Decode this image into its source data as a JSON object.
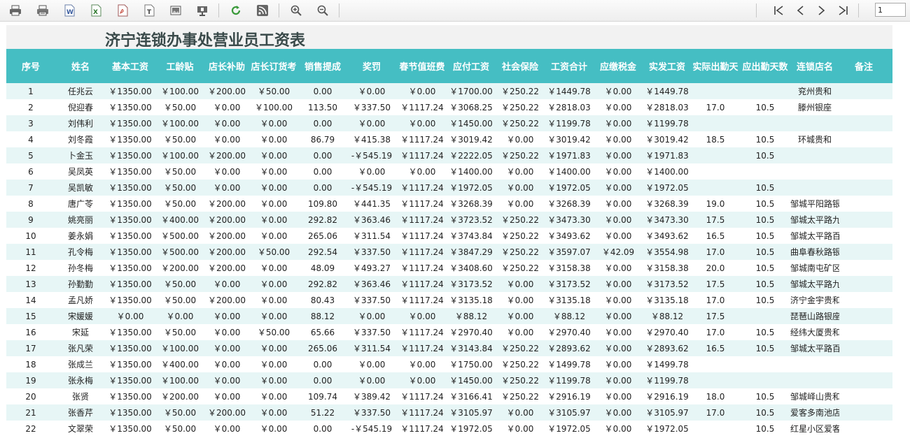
{
  "toolbar": {
    "page_number": "1",
    "icons": [
      "print-icon",
      "print-preview-icon",
      "export-word-icon",
      "export-excel-icon",
      "export-pdf-icon",
      "export-text-icon",
      "export-image-icon",
      "presentation-icon",
      "refresh-icon",
      "rss-icon",
      "zoom-in-icon",
      "zoom-out-icon",
      "first-page-icon",
      "prev-page-icon",
      "next-page-icon",
      "last-page-icon"
    ]
  },
  "colors": {
    "header_bg": "#45bec3",
    "row_alt_bg": "#e7f6f6",
    "title_bg": "#f2f2f2"
  },
  "report": {
    "title": "济宁连锁办事处营业员工资表",
    "columns": [
      "序号",
      "姓名",
      "基本工资",
      "工龄贴",
      "店长补助",
      "店长订货考",
      "销售提成",
      "奖罚",
      "春节值班费",
      "应付工资",
      "社会保险",
      "工资合计",
      "应缴税金",
      "实发工资",
      "实际出勤天",
      "应出勤天数",
      "连锁店名",
      "备注"
    ],
    "rows": [
      [
        "1",
        "任兆云",
        "￥1350.00",
        "￥100.00",
        "￥200.00",
        "￥50.00",
        "0.00",
        "￥0.00",
        "￥0.00",
        "￥1700.00",
        "￥250.22",
        "￥1449.78",
        "￥0.00",
        "￥1449.78",
        "",
        "",
        "兖州贵和",
        ""
      ],
      [
        "2",
        "倪迎春",
        "￥1350.00",
        "￥50.00",
        "￥0.00",
        "￥100.00",
        "113.50",
        "￥337.50",
        "￥1117.24",
        "￥3068.25",
        "￥250.22",
        "￥2818.03",
        "￥0.00",
        "￥2818.03",
        "17.0",
        "10.5",
        "滕州银座",
        ""
      ],
      [
        "3",
        "刘伟利",
        "￥1350.00",
        "￥100.00",
        "￥0.00",
        "￥0.00",
        "0.00",
        "￥0.00",
        "￥0.00",
        "￥1450.00",
        "￥250.22",
        "￥1199.78",
        "￥0.00",
        "￥1199.78",
        "",
        "",
        "",
        ""
      ],
      [
        "4",
        "刘冬霞",
        "￥1350.00",
        "￥50.00",
        "￥0.00",
        "￥0.00",
        "86.79",
        "￥415.38",
        "￥1117.24",
        "￥3019.42",
        "￥0.00",
        "￥3019.42",
        "￥0.00",
        "￥3019.42",
        "18.5",
        "10.5",
        "环城贵和",
        ""
      ],
      [
        "5",
        "卜金玉",
        "￥1350.00",
        "￥100.00",
        "￥200.00",
        "￥0.00",
        "0.00",
        "-￥545.19",
        "￥1117.24",
        "￥2222.05",
        "￥250.22",
        "￥1971.83",
        "￥0.00",
        "￥1971.83",
        "",
        "10.5",
        "",
        ""
      ],
      [
        "6",
        "吴凤英",
        "￥1350.00",
        "￥50.00",
        "￥0.00",
        "￥0.00",
        "0.00",
        "￥0.00",
        "￥0.00",
        "￥1400.00",
        "￥0.00",
        "￥1400.00",
        "￥0.00",
        "￥1400.00",
        "",
        "",
        "",
        ""
      ],
      [
        "7",
        "吴凯敏",
        "￥1350.00",
        "￥50.00",
        "￥0.00",
        "￥0.00",
        "0.00",
        "-￥545.19",
        "￥1117.24",
        "￥1972.05",
        "￥0.00",
        "￥1972.05",
        "￥0.00",
        "￥1972.05",
        "",
        "10.5",
        "",
        ""
      ],
      [
        "8",
        "唐广苓",
        "￥1350.00",
        "￥50.00",
        "￥200.00",
        "￥0.00",
        "109.80",
        "￥441.35",
        "￥1117.24",
        "￥3268.39",
        "￥0.00",
        "￥3268.39",
        "￥0.00",
        "￥3268.39",
        "19.0",
        "10.5",
        "邹城平阳路银",
        ""
      ],
      [
        "9",
        "姚亮丽",
        "￥1350.00",
        "￥400.00",
        "￥200.00",
        "￥0.00",
        "292.82",
        "￥363.46",
        "￥1117.24",
        "￥3723.52",
        "￥250.22",
        "￥3473.30",
        "￥0.00",
        "￥3473.30",
        "17.5",
        "10.5",
        "邹城太平路九",
        ""
      ],
      [
        "10",
        "姜永娟",
        "￥1350.00",
        "￥500.00",
        "￥200.00",
        "￥0.00",
        "265.06",
        "￥311.54",
        "￥1117.24",
        "￥3743.84",
        "￥250.22",
        "￥3493.62",
        "￥0.00",
        "￥3493.62",
        "16.5",
        "10.5",
        "邹城太平路百",
        ""
      ],
      [
        "11",
        "孔令梅",
        "￥1350.00",
        "￥500.00",
        "￥200.00",
        "￥50.00",
        "292.54",
        "￥337.50",
        "￥1117.24",
        "￥3847.29",
        "￥250.22",
        "￥3597.07",
        "￥42.09",
        "￥3554.98",
        "17.0",
        "10.5",
        "曲阜春秋路银",
        ""
      ],
      [
        "12",
        "孙冬梅",
        "￥1350.00",
        "￥200.00",
        "￥200.00",
        "￥0.00",
        "48.09",
        "￥493.27",
        "￥1117.24",
        "￥3408.60",
        "￥250.22",
        "￥3158.38",
        "￥0.00",
        "￥3158.38",
        "20.0",
        "10.5",
        "邹城南屯矿区",
        ""
      ],
      [
        "13",
        "孙勤勤",
        "￥1350.00",
        "￥50.00",
        "￥0.00",
        "￥0.00",
        "292.82",
        "￥363.46",
        "￥1117.24",
        "￥3173.52",
        "￥0.00",
        "￥3173.52",
        "￥0.00",
        "￥3173.52",
        "17.5",
        "10.5",
        "邹城太平路九",
        ""
      ],
      [
        "14",
        "孟凡娇",
        "￥1350.00",
        "￥50.00",
        "￥200.00",
        "￥0.00",
        "80.43",
        "￥337.50",
        "￥1117.24",
        "￥3135.18",
        "￥0.00",
        "￥3135.18",
        "￥0.00",
        "￥3135.18",
        "17.0",
        "10.5",
        "济宁金宇贵和",
        ""
      ],
      [
        "15",
        "宋媛媛",
        "￥0.00",
        "￥0.00",
        "￥0.00",
        "￥0.00",
        "88.12",
        "￥0.00",
        "￥0.00",
        "￥88.12",
        "￥0.00",
        "￥88.12",
        "￥0.00",
        "￥88.12",
        "17.5",
        "",
        "琵琶山路银座",
        ""
      ],
      [
        "16",
        "宋延",
        "￥1350.00",
        "￥50.00",
        "￥0.00",
        "￥50.00",
        "65.66",
        "￥337.50",
        "￥1117.24",
        "￥2970.40",
        "￥0.00",
        "￥2970.40",
        "￥0.00",
        "￥2970.40",
        "17.0",
        "10.5",
        "经纬大厦贵和",
        ""
      ],
      [
        "17",
        "张凡荣",
        "￥1350.00",
        "￥100.00",
        "￥0.00",
        "￥0.00",
        "265.06",
        "￥311.54",
        "￥1117.24",
        "￥3143.84",
        "￥250.22",
        "￥2893.62",
        "￥0.00",
        "￥2893.62",
        "16.5",
        "10.5",
        "邹城太平路百",
        ""
      ],
      [
        "18",
        "张成兰",
        "￥1350.00",
        "￥400.00",
        "￥0.00",
        "￥0.00",
        "0.00",
        "￥0.00",
        "￥0.00",
        "￥1750.00",
        "￥250.22",
        "￥1499.78",
        "￥0.00",
        "￥1499.78",
        "",
        "",
        "",
        ""
      ],
      [
        "19",
        "张永梅",
        "￥1350.00",
        "￥100.00",
        "￥0.00",
        "￥0.00",
        "0.00",
        "￥0.00",
        "￥0.00",
        "￥1450.00",
        "￥250.22",
        "￥1199.78",
        "￥0.00",
        "￥1199.78",
        "",
        "",
        "",
        ""
      ],
      [
        "20",
        "张贤",
        "￥1350.00",
        "￥200.00",
        "￥0.00",
        "￥0.00",
        "109.74",
        "￥389.42",
        "￥1117.24",
        "￥3166.41",
        "￥250.22",
        "￥2916.19",
        "￥0.00",
        "￥2916.19",
        "18.0",
        "10.5",
        "邹城峄山贵和",
        ""
      ],
      [
        "21",
        "张香芹",
        "￥1350.00",
        "￥50.00",
        "￥200.00",
        "￥0.00",
        "51.22",
        "￥337.50",
        "￥1117.24",
        "￥3105.97",
        "￥0.00",
        "￥3105.97",
        "￥0.00",
        "￥3105.97",
        "17.0",
        "10.5",
        "爱客多南池店",
        ""
      ],
      [
        "22",
        "文翠荣",
        "￥1350.00",
        "￥50.00",
        "￥0.00",
        "￥0.00",
        "0.00",
        "-￥545.19",
        "￥1117.24",
        "￥1972.05",
        "￥0.00",
        "￥1972.05",
        "￥0.00",
        "￥1972.05",
        "",
        "10.5",
        "红星小区爱客",
        ""
      ]
    ]
  }
}
